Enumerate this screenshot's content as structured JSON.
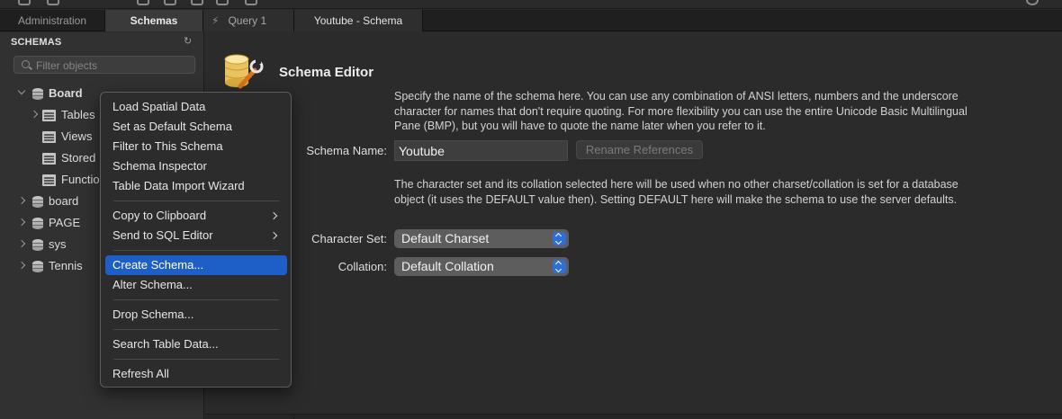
{
  "tabs": {
    "administration": "Administration",
    "schemas": "Schemas",
    "query": "Query 1",
    "schema_doc": "Youtube - Schema"
  },
  "sidebar": {
    "title": "SCHEMAS",
    "filter_placeholder": "Filter objects",
    "tree": [
      {
        "label": "Board",
        "expanded": true,
        "bold": true
      },
      {
        "label": "Tables"
      },
      {
        "label": "Views"
      },
      {
        "label": "Stored"
      },
      {
        "label": "Functio"
      },
      {
        "label": "board"
      },
      {
        "label": "PAGE"
      },
      {
        "label": "sys"
      },
      {
        "label": "Tennis"
      }
    ]
  },
  "editor": {
    "title": "Schema Editor",
    "intro": "Specify the name of the schema here. You can use any combination of ANSI letters, numbers and the underscore character for names that don't require quoting. For more flexibility you can use the entire Unicode Basic Multilingual Pane (BMP), but you will have to quote the name later when you refer to it.",
    "schema_name_label": "Schema Name:",
    "schema_name_value": "Youtube",
    "rename_button": "Rename References",
    "charset_text": "The character set and its collation selected here will be used when no other charset/collation is set for a database object (it uses the DEFAULT value then). Setting DEFAULT here will make the schema to use the server defaults.",
    "charset_label": "Character Set:",
    "charset_value": "Default Charset",
    "collation_label": "Collation:",
    "collation_value": "Default Collation"
  },
  "context_menu": {
    "items": [
      {
        "label": "Load Spatial Data"
      },
      {
        "label": "Set as Default Schema"
      },
      {
        "label": "Filter to This Schema"
      },
      {
        "label": "Schema Inspector"
      },
      {
        "label": "Table Data Import Wizard"
      },
      {
        "label": "Copy to Clipboard",
        "submenu": true
      },
      {
        "label": "Send to SQL Editor",
        "submenu": true
      },
      {
        "label": "Create Schema...",
        "highlighted": true
      },
      {
        "label": "Alter Schema..."
      },
      {
        "label": "Drop Schema..."
      },
      {
        "label": "Search Table Data..."
      },
      {
        "label": "Refresh All"
      }
    ]
  },
  "colors": {
    "highlight": "#1e5fc7",
    "select_arrow": "#2f6fd6"
  },
  "icons": [
    "lightning-icon",
    "search-icon",
    "refresh-icon",
    "database-icon",
    "folder-icon",
    "schema-editor-icon",
    "chevron-right-icon",
    "chevron-down-icon"
  ]
}
